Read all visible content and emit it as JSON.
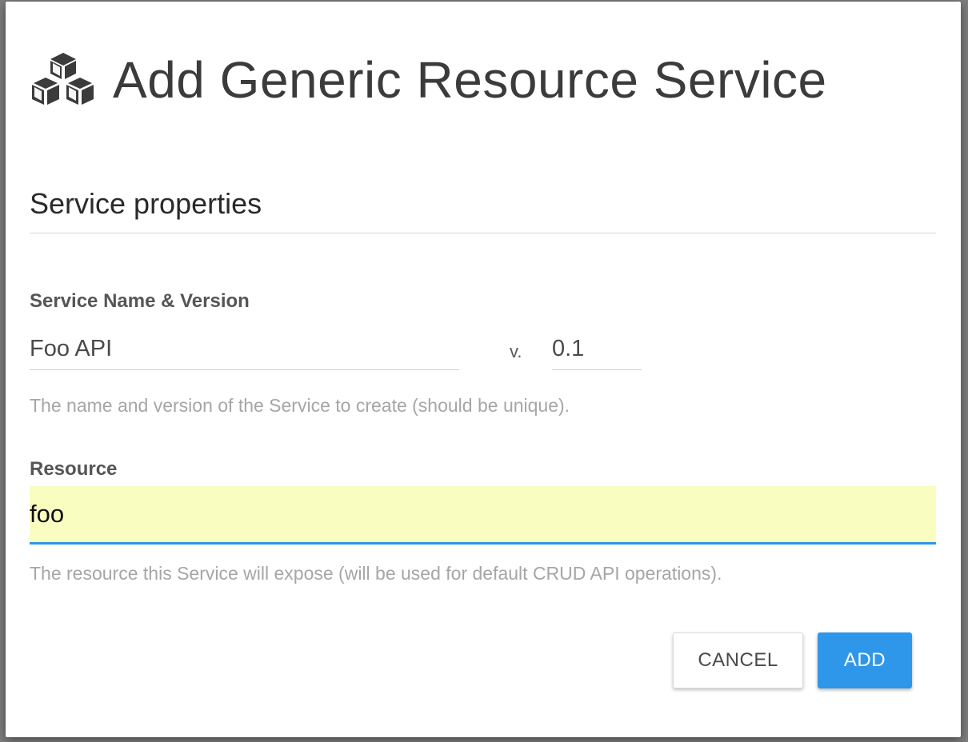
{
  "dialog": {
    "title": "Add Generic Resource Service",
    "icon": "cubes-icon"
  },
  "section": {
    "title": "Service properties"
  },
  "service_name": {
    "label": "Service Name & Version",
    "name_value": "Foo API",
    "version_separator": "v.",
    "version_value": "0.1",
    "help_text": "The name and version of the Service to create (should be unique)."
  },
  "resource": {
    "label": "Resource",
    "value": "foo",
    "help_text": "The resource this Service will expose (will be used for default CRUD API operations)."
  },
  "buttons": {
    "cancel_label": "CANCEL",
    "add_label": "ADD"
  },
  "colors": {
    "primary": "#2f97e9",
    "autofill_background": "#f9fdc0",
    "title_text": "#3b3b3b"
  }
}
